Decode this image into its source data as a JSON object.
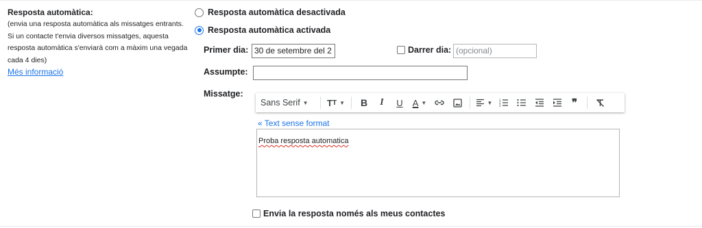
{
  "vacation": {
    "section_title": "Resposta automàtica:",
    "description_lines": [
      "(envia una resposta automàtica als missatges entrants.",
      "Si un contacte t'envia diversos missatges, aquesta",
      "resposta automàtica s'enviarà com a màxim una vegada",
      "cada 4 dies)"
    ],
    "more_info_link": "Més informació",
    "option_off": "Resposta automàtica desactivada",
    "option_on": "Resposta automàtica activada",
    "first_day_label": "Primer dia:",
    "first_day_value": "30 de setembre del 2",
    "last_day_label": "Darrer dia:",
    "last_day_placeholder": "(opcional)",
    "subject_label": "Assumpte:",
    "subject_value": "",
    "message_label": "Missatge:",
    "toolbar": {
      "font_family": "Sans Serif",
      "icons": [
        "text-size-icon",
        "bold-icon",
        "italic-icon",
        "underline-icon",
        "text-color-icon",
        "link-icon",
        "image-icon",
        "align-icon",
        "numbered-list-icon",
        "bulleted-list-icon",
        "indent-less-icon",
        "indent-more-icon",
        "quote-icon",
        "remove-formatting-icon"
      ]
    },
    "plain_text_link": "« Text sense format",
    "message_body": "Proba resposta automatica",
    "contacts_only_label": "Envia la resposta només als meus contactes"
  },
  "colors": {
    "accent": "#1a73e8",
    "text": "#202124",
    "border": "#767676",
    "spellcheck": "#d93025"
  }
}
